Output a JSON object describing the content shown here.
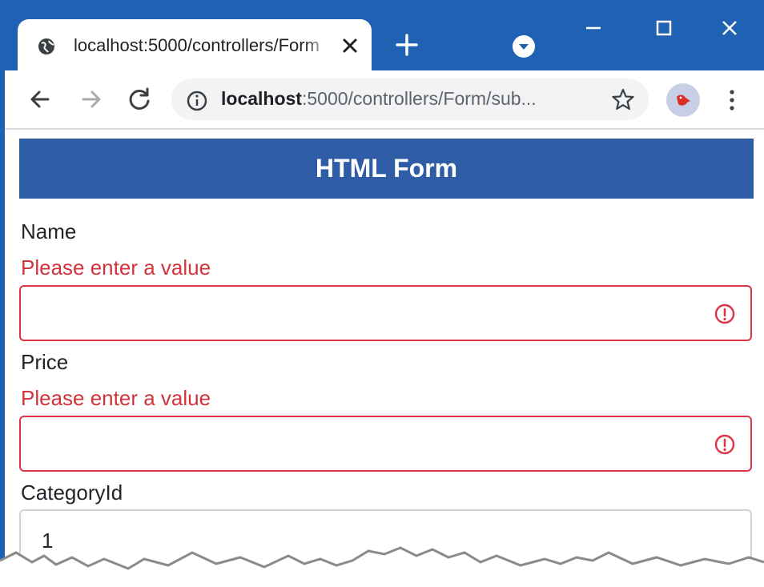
{
  "browser": {
    "tab": {
      "title": "localhost:5000/controllers/Form",
      "close_label": "×"
    },
    "new_tab_label": "+",
    "address_bar": {
      "url_host": "localhost",
      "url_rest": ":5000/controllers/Form/sub..."
    },
    "icons": {
      "favicon": "globe-icon",
      "back": "back-arrow-icon",
      "forward": "forward-arrow-icon",
      "reload": "reload-icon",
      "site_info": "info-icon",
      "bookmark": "star-icon",
      "profile": "profile-avatar-icon",
      "menu": "kebab-menu-icon",
      "tab_search": "tab-search-icon"
    },
    "colors": {
      "chrome_blue": "#1f62b4",
      "omnibox_bg": "#f1f3f4"
    }
  },
  "page": {
    "header_title": "HTML Form",
    "fields": [
      {
        "label": "Name",
        "error": "Please enter a value",
        "value": ""
      },
      {
        "label": "Price",
        "error": "Please enter a value",
        "value": ""
      },
      {
        "label": "CategoryId",
        "value": "1"
      }
    ],
    "colors": {
      "header_bg": "#2e5da6",
      "error": "#d2343b",
      "input_border_invalid": "#dc3545",
      "input_border_normal": "#cfd4da"
    }
  }
}
